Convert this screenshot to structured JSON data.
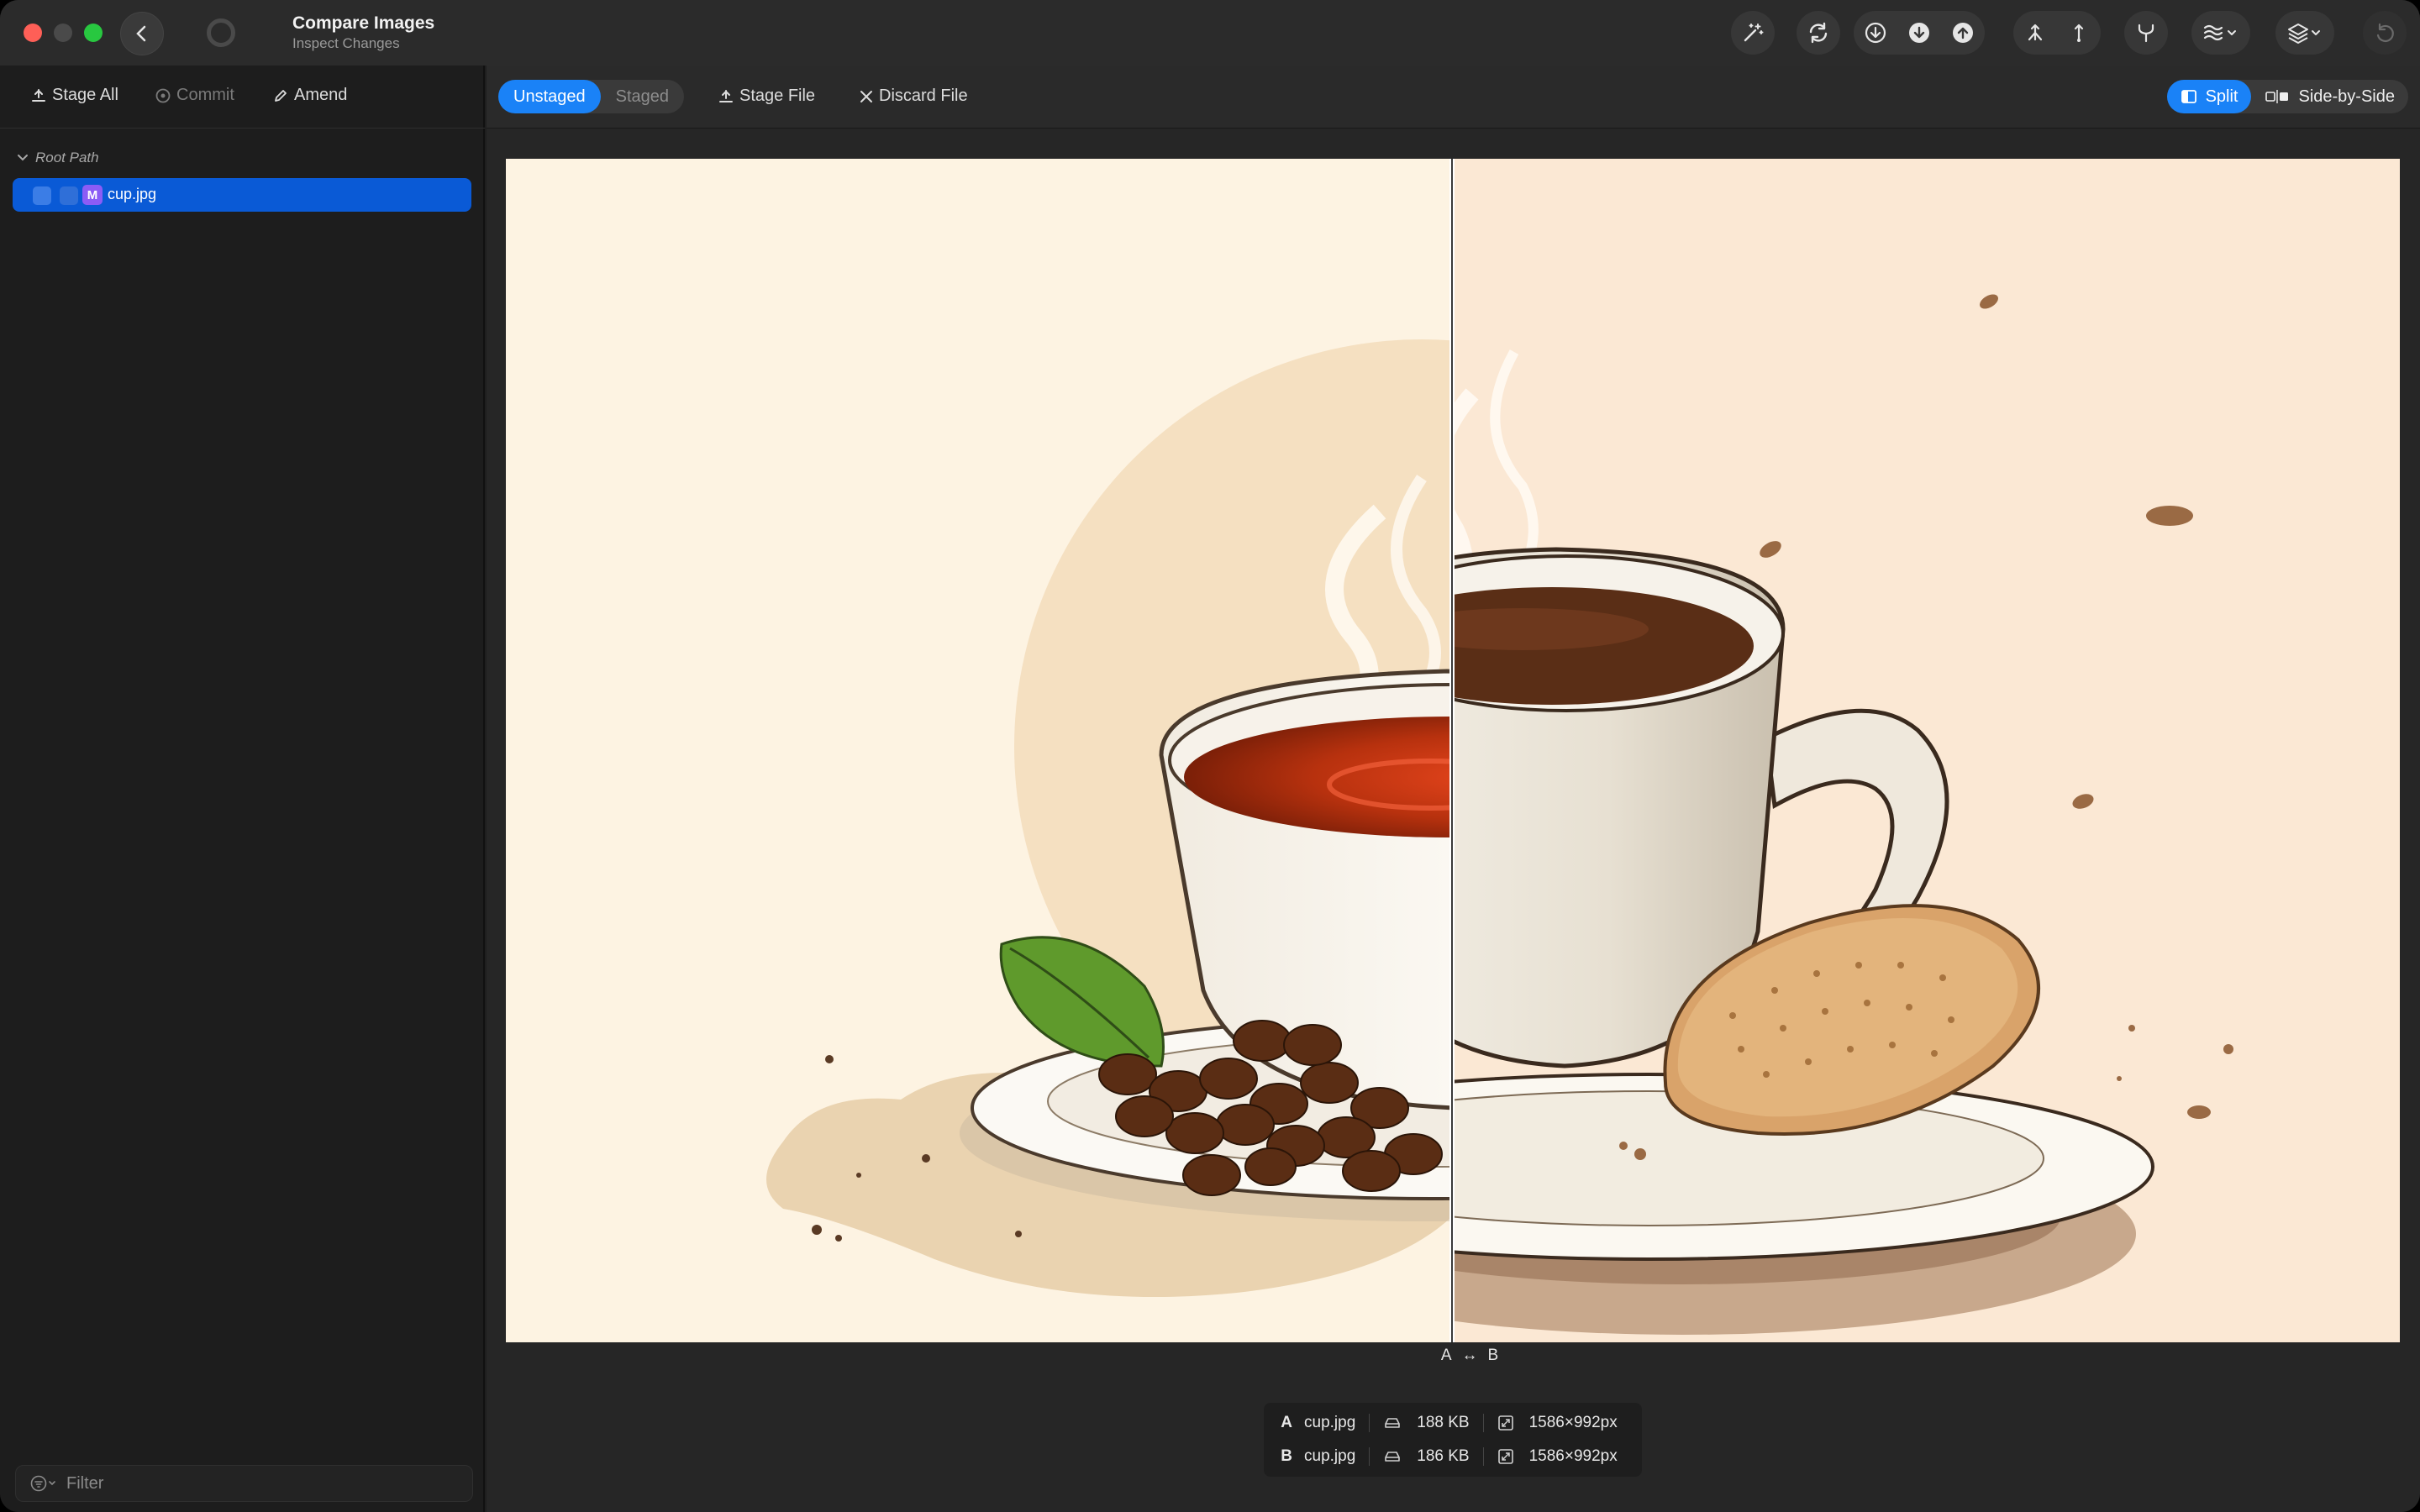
{
  "window": {
    "title": "Compare Images",
    "subtitle": "Inspect Changes"
  },
  "toolbar_icons": [
    "magic-wand-icon",
    "sync-icon",
    "fetch-icon",
    "pull-icon",
    "push-icon",
    "merge-icon",
    "branch-up-icon",
    "fork-icon",
    "stash-icon",
    "layers-icon",
    "undo-icon"
  ],
  "sidebar": {
    "actions": {
      "stage_all": "Stage All",
      "commit": "Commit",
      "amend": "Amend"
    },
    "tree": {
      "root_label": "Root Path",
      "files": [
        {
          "badge": "M",
          "name": "cup.jpg"
        }
      ]
    },
    "filter_placeholder": "Filter"
  },
  "main": {
    "tabs": {
      "unstaged": "Unstaged",
      "staged": "Staged"
    },
    "actions": {
      "stage_file": "Stage File",
      "discard_file": "Discard File"
    },
    "view_modes": {
      "split": "Split",
      "side_by_side": "Side-by-Side"
    },
    "compare_label": {
      "a": "A",
      "arrow": "↔",
      "b": "B"
    },
    "info": {
      "a": {
        "label": "A",
        "file": "cup.jpg",
        "size": "188 KB",
        "dims": "1586×992px"
      },
      "b": {
        "label": "B",
        "file": "cup.jpg",
        "size": "186 KB",
        "dims": "1586×992px"
      }
    }
  },
  "colors": {
    "accent": "#1a82f7",
    "selection": "#0a5ad6",
    "modified_badge": "#8b5cf6"
  }
}
